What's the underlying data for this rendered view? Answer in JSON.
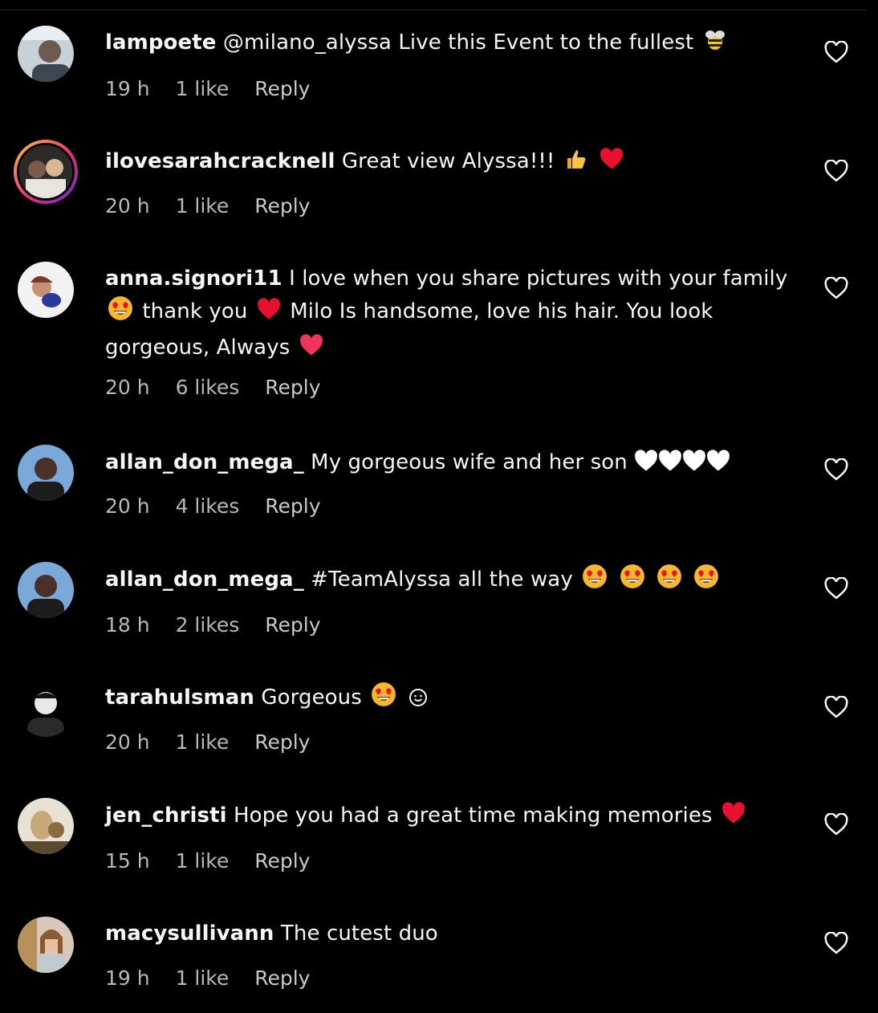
{
  "comments": [
    {
      "username": "lampoete",
      "text": "@milano_alyssa Live this Event to the fullest",
      "emojis": [
        "bee-emoji"
      ],
      "time": "19 h",
      "likes": "1 like",
      "reply": "Reply"
    },
    {
      "username": "ilovesarahcracknell",
      "text": "Great view Alyssa!!!",
      "emojis": [
        "thumbs-up-emoji",
        "red-heart-emoji"
      ],
      "time": "20 h",
      "likes": "1 like",
      "reply": "Reply",
      "story_ring": true
    },
    {
      "username": "anna.signori11",
      "text1": "I love when you share pictures with your family",
      "text2": "thank you",
      "text3": "Milo Is handsome, love his hair. You look",
      "text4": "gorgeous, Always",
      "time": "20 h",
      "likes": "6 likes",
      "reply": "Reply"
    },
    {
      "username": "allan_don_mega_",
      "text": "My gorgeous wife and her son",
      "emojis": [
        "white-heart-emoji",
        "white-heart-emoji",
        "white-heart-emoji",
        "white-heart-emoji"
      ],
      "time": "20 h",
      "likes": "4 likes",
      "reply": "Reply"
    },
    {
      "username": "allan_don_mega_",
      "text": "#TeamAlyssa all the way",
      "emojis": [
        "heart-eyes-emoji",
        "heart-eyes-emoji",
        "heart-eyes-emoji",
        "heart-eyes-emoji"
      ],
      "time": "18 h",
      "likes": "2 likes",
      "reply": "Reply"
    },
    {
      "username": "tarahulsman",
      "text": "Gorgeous",
      "emojis": [
        "heart-eyes-emoji",
        "smile-emoji"
      ],
      "time": "20 h",
      "likes": "1 like",
      "reply": "Reply"
    },
    {
      "username": "jen_christi",
      "text": "Hope you had a great time making memories",
      "emojis": [
        "red-heart-emoji"
      ],
      "time": "15 h",
      "likes": "1 like",
      "reply": "Reply"
    },
    {
      "username": "macysullivann",
      "text": "The cutest duo",
      "time": "19 h",
      "likes": "1 like",
      "reply": "Reply"
    }
  ],
  "colors": {
    "background": "#000000",
    "text": "#f5f5f5",
    "meta": "#b8b8b8",
    "heart_red": "#e8112d"
  }
}
